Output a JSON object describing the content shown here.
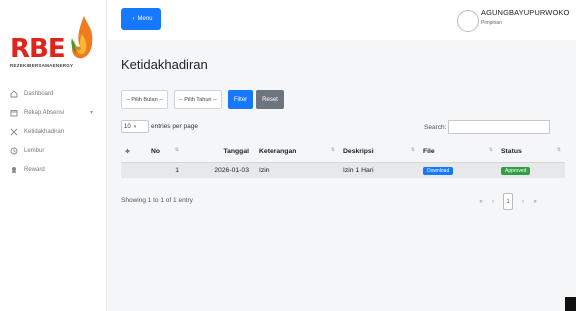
{
  "brand": {
    "logo_text": "RBE",
    "tagline": "REZEKIBERSAMAENERGY",
    "logo_color": "#e2231a"
  },
  "sidebar": {
    "items": [
      {
        "label": "Dashboard",
        "icon": "home-icon"
      },
      {
        "label": "Rekap Absensi",
        "icon": "calendar-icon"
      },
      {
        "label": "Ketidakhadiran",
        "icon": "x-icon"
      },
      {
        "label": "Lembur",
        "icon": "clock-icon"
      },
      {
        "label": "Reward",
        "icon": "award-icon"
      }
    ]
  },
  "topbar": {
    "menu_label": "Menu",
    "username": "AGUNGBAYUPURWOKO",
    "role": "Pimpinan"
  },
  "page": {
    "title": "Ketidakhadiran"
  },
  "filters": {
    "month": "-- Pilih Bulan --",
    "year": "-- Pilih Tahun --",
    "filter_label": "Filter",
    "reset_label": "Reset"
  },
  "table_controls": {
    "length_value": "10",
    "length_suffix": "entries per page",
    "search_label": "Search:"
  },
  "table": {
    "headers": [
      "No",
      "Tanggal",
      "Keterangan",
      "Deskripsi",
      "File",
      "Status"
    ],
    "rows": [
      {
        "no": "1",
        "tanggal": "2026-01-03",
        "keterangan": "Izin",
        "deskripsi": "Izin 1 Hari",
        "file": "Download",
        "status": "Approved"
      }
    ]
  },
  "footer": {
    "info": "Showing 1 to 1 of 1 entry",
    "page": "1"
  },
  "colors": {
    "primary": "#1677ff",
    "success": "#2f9e44",
    "secondary": "#6c757d"
  }
}
